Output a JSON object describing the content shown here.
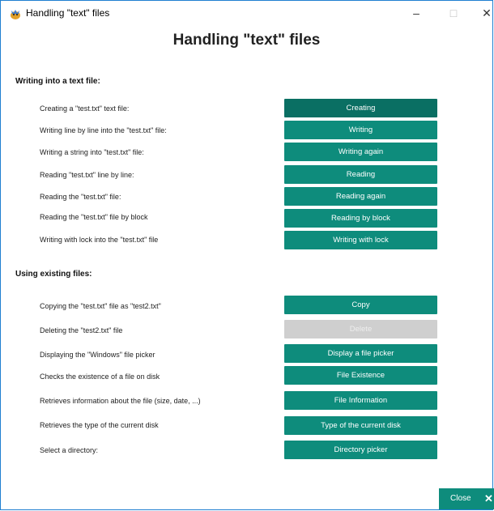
{
  "window": {
    "title": "Handling \"text\" files",
    "minimize": "–",
    "maximize": "□",
    "close": "✕"
  },
  "heading": "Handling \"text\" files",
  "sections": {
    "writing": "Writing into a text file:",
    "existing": "Using existing files:"
  },
  "rows": [
    {
      "label": "Creating a \"test.txt\" text file:",
      "button": "Creating"
    },
    {
      "label": "Writing line by line into the \"test.txt\" file:",
      "button": "Writing"
    },
    {
      "label": "Writing a string into \"test.txt\" file:",
      "button": "Writing again"
    },
    {
      "label": "Reading \"test.txt\" line by line:",
      "button": "Reading"
    },
    {
      "label": "Reading the \"test.txt\" file:",
      "button": "Reading again"
    },
    {
      "label": "Reading the \"test.txt\" file by block",
      "button": "Reading by block"
    },
    {
      "label": "Writing with lock into the \"test.txt\" file",
      "button": "Writing with lock"
    },
    {
      "label": "Copying the \"test.txt\" file as \"test2.txt\"",
      "button": "Copy"
    },
    {
      "label": "Deleting the \"test2.txt\" file",
      "button": "Delete"
    },
    {
      "label": "Displaying the \"Windows\" file picker",
      "button": "Display a file picker"
    },
    {
      "label": "Checks the existence of a file on disk",
      "button": "File Existence"
    },
    {
      "label": "Retrieves information about the file (size, date, ...)",
      "button": "File Information"
    },
    {
      "label": "Retrieves the type of the current disk",
      "button": "Type of the current disk"
    },
    {
      "label": "Select a directory:",
      "button": "Directory picker"
    }
  ],
  "footer": {
    "close_label": "Close",
    "close_icon": "✕"
  }
}
